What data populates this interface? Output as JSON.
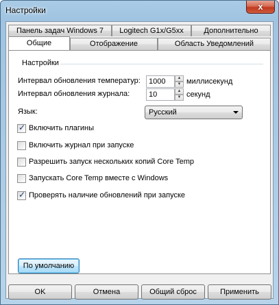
{
  "window": {
    "title": "Настройки",
    "close_glyph": "x"
  },
  "tabs_row1": [
    {
      "label": "Панель задач Windows 7"
    },
    {
      "label": "Logitech G1x/G5xx"
    },
    {
      "label": "Дополнительно"
    }
  ],
  "tabs_row2": [
    {
      "label": "Общие",
      "active": true
    },
    {
      "label": "Отображение"
    },
    {
      "label": "Область Уведомлений"
    }
  ],
  "general": {
    "group_title": "Настройки",
    "temp_interval": {
      "label": "Интервал обновления температур:",
      "value": "1000",
      "unit": "миллисекунд"
    },
    "log_interval": {
      "label": "Интервал обновления журнала:",
      "value": "10",
      "unit": "секунд"
    },
    "language": {
      "label": "Язык:",
      "selected": "Русский"
    },
    "checkboxes": [
      {
        "label": "Включить плагины",
        "checked": true
      },
      {
        "label": "Включить журнал при запуске",
        "checked": false
      },
      {
        "label": "Разрешить запуск нескольких копий Core Temp",
        "checked": false
      },
      {
        "label": "Запускать Core Temp вместе с Windows",
        "checked": false
      },
      {
        "label": "Проверять наличие обновлений при запуске",
        "checked": true
      }
    ],
    "defaults_button": "По умолчанию"
  },
  "footer": {
    "ok": "OK",
    "cancel": "Отмена",
    "reset": "Общий сброс",
    "apply": "Применить"
  },
  "icons": {
    "spin_up": "▲",
    "spin_down": "▼",
    "check": "✓"
  }
}
